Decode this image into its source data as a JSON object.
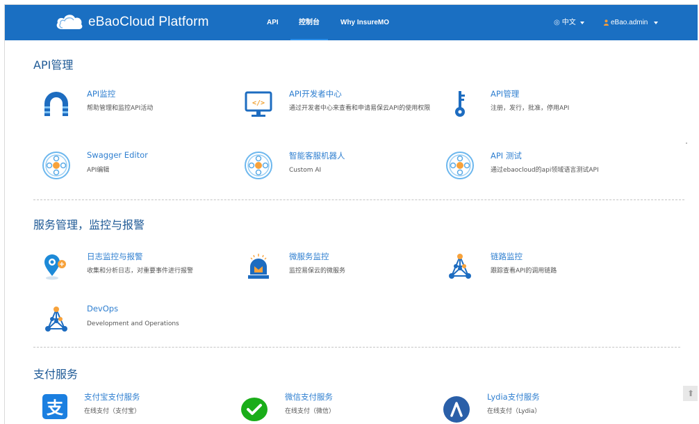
{
  "navbar": {
    "brand": "eBaoCloud Platform",
    "links": [
      "API",
      "控制台",
      "Why InsureMO"
    ],
    "language": "中文",
    "user": "eBao.admin"
  },
  "sections": [
    {
      "title": "API管理",
      "tiles": [
        {
          "title": "API监控",
          "desc": "帮助管理和监控API活动",
          "icon": "gateway-icon"
        },
        {
          "title": "API开发者中心",
          "desc": "通过开发者中心来查看和申请易保云API的使用权限",
          "icon": "code-monitor-icon"
        },
        {
          "title": "API管理",
          "desc": "注册，发行，批准，停用API",
          "icon": "key-icon"
        },
        {
          "title": "Swagger Editor",
          "desc": "API编辑",
          "icon": "swagger-icon"
        },
        {
          "title": "智能客服机器人",
          "desc": "Custom AI",
          "icon": "robot-icon"
        },
        {
          "title": "API 测试",
          "desc": "通过ebaocloud的api领域语言测试API",
          "icon": "test-icon"
        }
      ]
    },
    {
      "title": "服务管理，监控与报警",
      "tiles": [
        {
          "title": "日志监控与报警",
          "desc": "收集和分析日志，对重要事件进行报警",
          "icon": "log-alarm-icon"
        },
        {
          "title": "微服务监控",
          "desc": "监控易保云的微服务",
          "icon": "alarm-light-icon"
        },
        {
          "title": "链路监控",
          "desc": "跟踪查看API的调用链路",
          "icon": "network-icon"
        },
        {
          "title": "DevOps",
          "desc": "Development and Operations",
          "icon": "devops-icon"
        }
      ]
    },
    {
      "title": "支付服务",
      "tiles": [
        {
          "title": "支付宝支付服务",
          "desc": "在线支付（支付宝）",
          "icon": "alipay-icon"
        },
        {
          "title": "微信支付服务",
          "desc": "在线支付（微信）",
          "icon": "wechat-icon"
        },
        {
          "title": "Lydia支付服务",
          "desc": "在线支付（Lydia）",
          "icon": "lydia-icon"
        }
      ]
    }
  ],
  "colors": {
    "navbar": "#1a6fc2",
    "accent": "#2a8eea",
    "section_title": "#1f5a96",
    "tile_title": "#2f7fd0",
    "alipay": "#1b7fe0",
    "wechat": "#1aad19",
    "lydia": "#2a5fa8"
  }
}
